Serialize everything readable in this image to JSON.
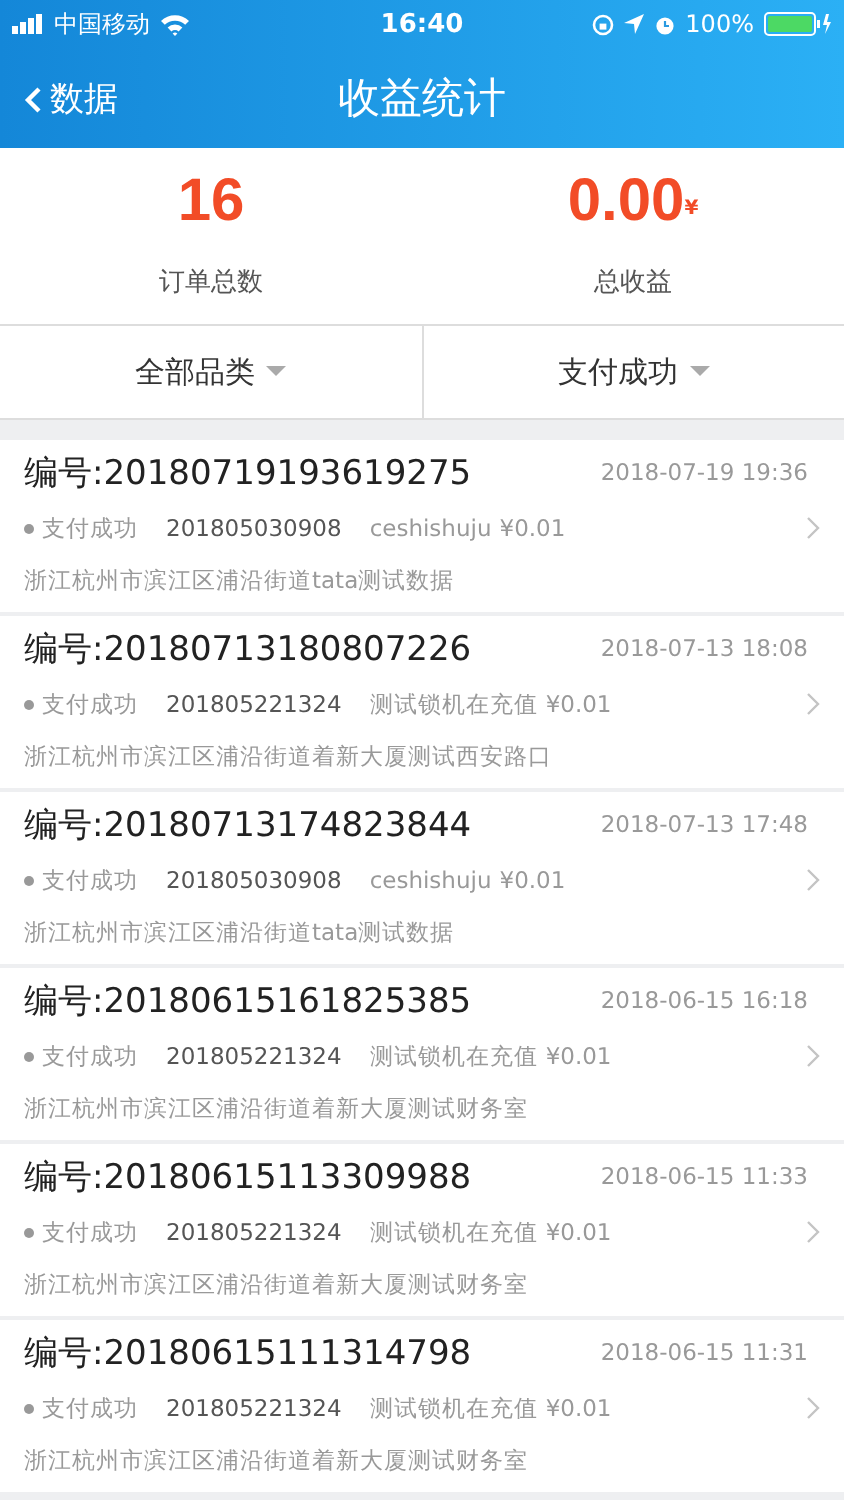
{
  "status_bar": {
    "carrier": "中国移动",
    "time": "16:40",
    "battery": "100%"
  },
  "nav": {
    "back": "数据",
    "title": "收益统计"
  },
  "stats": [
    {
      "value": "16",
      "label": "订单总数"
    },
    {
      "value": "0.00",
      "currency": "¥",
      "label": "总收益"
    }
  ],
  "filters": [
    "全部品类",
    "支付成功"
  ],
  "orders": [
    {
      "number": "编号:20180719193619275",
      "time": "2018-07-19 19:36",
      "status": "支付成功",
      "code": "201805030908",
      "name": "ceshishuju",
      "amount": "¥0.01",
      "address": "浙江杭州市滨江区浦沿街道tata测试数据"
    },
    {
      "number": "编号:20180713180807226",
      "time": "2018-07-13 18:08",
      "status": "支付成功",
      "code": "201805221324",
      "name": "测试锁机在充值",
      "amount": "¥0.01",
      "address": "浙江杭州市滨江区浦沿街道着新大厦测试西安路口"
    },
    {
      "number": "编号:20180713174823844",
      "time": "2018-07-13 17:48",
      "status": "支付成功",
      "code": "201805030908",
      "name": "ceshishuju",
      "amount": "¥0.01",
      "address": "浙江杭州市滨江区浦沿街道tata测试数据"
    },
    {
      "number": "编号:20180615161825385",
      "time": "2018-06-15 16:18",
      "status": "支付成功",
      "code": "201805221324",
      "name": "测试锁机在充值",
      "amount": "¥0.01",
      "address": "浙江杭州市滨江区浦沿街道着新大厦测试财务室"
    },
    {
      "number": "编号:20180615113309988",
      "time": "2018-06-15 11:33",
      "status": "支付成功",
      "code": "201805221324",
      "name": "测试锁机在充值",
      "amount": "¥0.01",
      "address": "浙江杭州市滨江区浦沿街道着新大厦测试财务室"
    },
    {
      "number": "编号:20180615111314798",
      "time": "2018-06-15 11:31",
      "status": "支付成功",
      "code": "201805221324",
      "name": "测试锁机在充值",
      "amount": "¥0.01",
      "address": "浙江杭州市滨江区浦沿街道着新大厦测试财务室"
    }
  ]
}
